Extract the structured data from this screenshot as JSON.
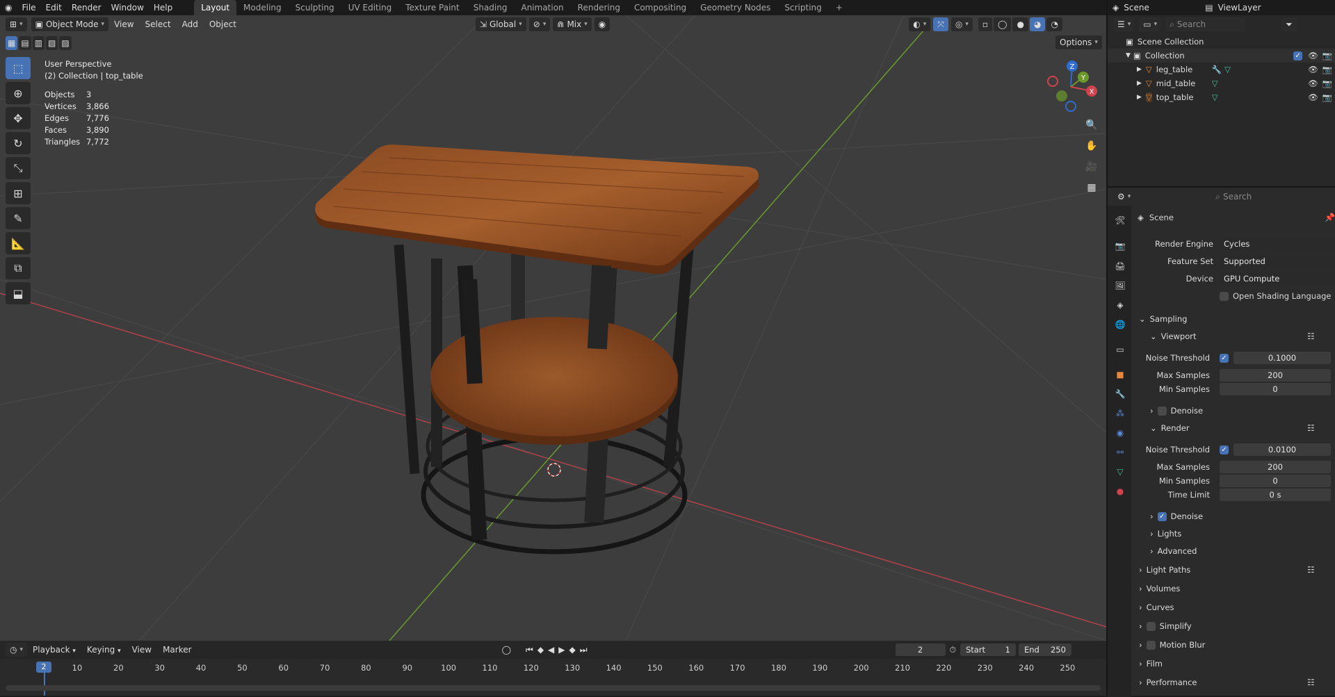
{
  "topbar": {
    "menus": [
      "File",
      "Edit",
      "Render",
      "Window",
      "Help"
    ],
    "workspaces": [
      "Layout",
      "Modeling",
      "Sculpting",
      "UV Editing",
      "Texture Paint",
      "Shading",
      "Animation",
      "Rendering",
      "Compositing",
      "Geometry Nodes",
      "Scripting"
    ],
    "active_workspace": "Layout",
    "add_workspace": "+",
    "scene": "Scene",
    "view_layer": "ViewLayer"
  },
  "viewport_header": {
    "mode": "Object Mode",
    "menus": [
      "View",
      "Select",
      "Add",
      "Object"
    ],
    "transform_orientation": "Global",
    "snap_mode": "Mix",
    "options": "Options"
  },
  "overlay": {
    "view_name": "User Perspective",
    "collection_info": "(2) Collection | top_table",
    "stats": [
      {
        "label": "Objects",
        "value": "3"
      },
      {
        "label": "Vertices",
        "value": "3,866"
      },
      {
        "label": "Edges",
        "value": "7,776"
      },
      {
        "label": "Faces",
        "value": "3,890"
      },
      {
        "label": "Triangles",
        "value": "7,772"
      }
    ]
  },
  "gizmo": {
    "x": "X",
    "y": "Y",
    "z": "Z"
  },
  "outliner": {
    "search_placeholder": "Search",
    "scene_collection": "Scene Collection",
    "collection": "Collection",
    "objects": [
      "leg_table",
      "mid_table",
      "top_table"
    ]
  },
  "properties": {
    "search_placeholder": "Search",
    "context": "Scene",
    "render_engine_label": "Render Engine",
    "render_engine": "Cycles",
    "feature_set_label": "Feature Set",
    "feature_set": "Supported",
    "device_label": "Device",
    "device": "GPU Compute",
    "osl_label": "Open Shading Language",
    "sampling": "Sampling",
    "viewport": "Viewport",
    "render": "Render",
    "noise_threshold_label": "Noise Threshold",
    "max_samples_label": "Max Samples",
    "min_samples_label": "Min Samples",
    "time_limit_label": "Time Limit",
    "viewport_noise": "0.1000",
    "viewport_max": "200",
    "viewport_min": "0",
    "viewport_denoise": "Denoise",
    "render_noise": "0.0100",
    "render_max": "200",
    "render_min": "0",
    "render_time_limit": "0 s",
    "render_denoise": "Denoise",
    "lights": "Lights",
    "advanced": "Advanced",
    "light_paths": "Light Paths",
    "volumes": "Volumes",
    "curves": "Curves",
    "simplify": "Simplify",
    "motion_blur": "Motion Blur",
    "film": "Film",
    "performance": "Performance"
  },
  "timeline": {
    "menus": [
      "Playback",
      "Keying",
      "View",
      "Marker"
    ],
    "current_frame": "2",
    "start_label": "Start",
    "start": "1",
    "end_label": "End",
    "end": "250",
    "ticks": [
      "10",
      "20",
      "30",
      "40",
      "50",
      "60",
      "70",
      "80",
      "90",
      "100",
      "110",
      "120",
      "130",
      "140",
      "150",
      "160",
      "170",
      "180",
      "190",
      "200",
      "210",
      "220",
      "230",
      "240",
      "250"
    ]
  },
  "colors": {
    "accent": "#4772b3",
    "viewport_bg": "#3d3d3d",
    "x_axis": "#b3414a",
    "y_axis": "#6b9a2b"
  }
}
